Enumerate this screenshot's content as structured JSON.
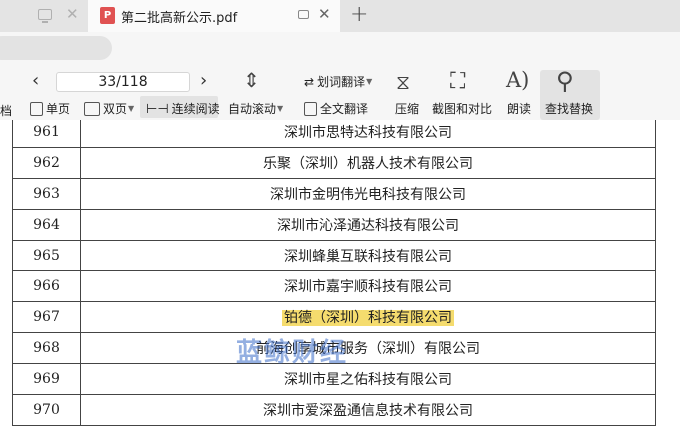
{
  "tabs": {
    "active_title": "第二批高新公示.pdf",
    "pdf_icon_label": "P"
  },
  "toolbar": {
    "left_fragment": "档",
    "page_indicator": "33/118",
    "single_page": "单页",
    "double_page": "双页",
    "continuous_read": "连续阅读",
    "auto_scroll": "自动滚动",
    "word_translate": "划词翻译",
    "full_translate": "全文翻译",
    "compress": "压缩",
    "screenshot_compare": "截图和对比",
    "read_aloud": "朗读",
    "find_replace": "查找替换"
  },
  "table": {
    "rows": [
      {
        "num": "961",
        "name": "深圳市思特达科技有限公司"
      },
      {
        "num": "962",
        "name": "乐聚（深圳）机器人技术有限公司"
      },
      {
        "num": "963",
        "name": "深圳市金明伟光电科技有限公司"
      },
      {
        "num": "964",
        "name": "深圳市沁泽通达科技有限公司"
      },
      {
        "num": "965",
        "name": "深圳蜂巢互联科技有限公司"
      },
      {
        "num": "966",
        "name": "深圳市嘉宇顺科技有限公司"
      },
      {
        "num": "967",
        "name": "铂德（深圳）科技有限公司",
        "highlighted": true
      },
      {
        "num": "968",
        "name": "前海创享城市服务（深圳）有限公司"
      },
      {
        "num": "969",
        "name": "深圳市星之佑科技有限公司"
      },
      {
        "num": "970",
        "name": "深圳市爱深盈通信息技术有限公司"
      }
    ]
  },
  "watermark": "蓝鲸财经",
  "colors": {
    "highlight": "#f5dc6e",
    "pdf_icon": "#e05252",
    "tabbar": "#e4e4e4",
    "toolbar": "#f6f6f6"
  }
}
